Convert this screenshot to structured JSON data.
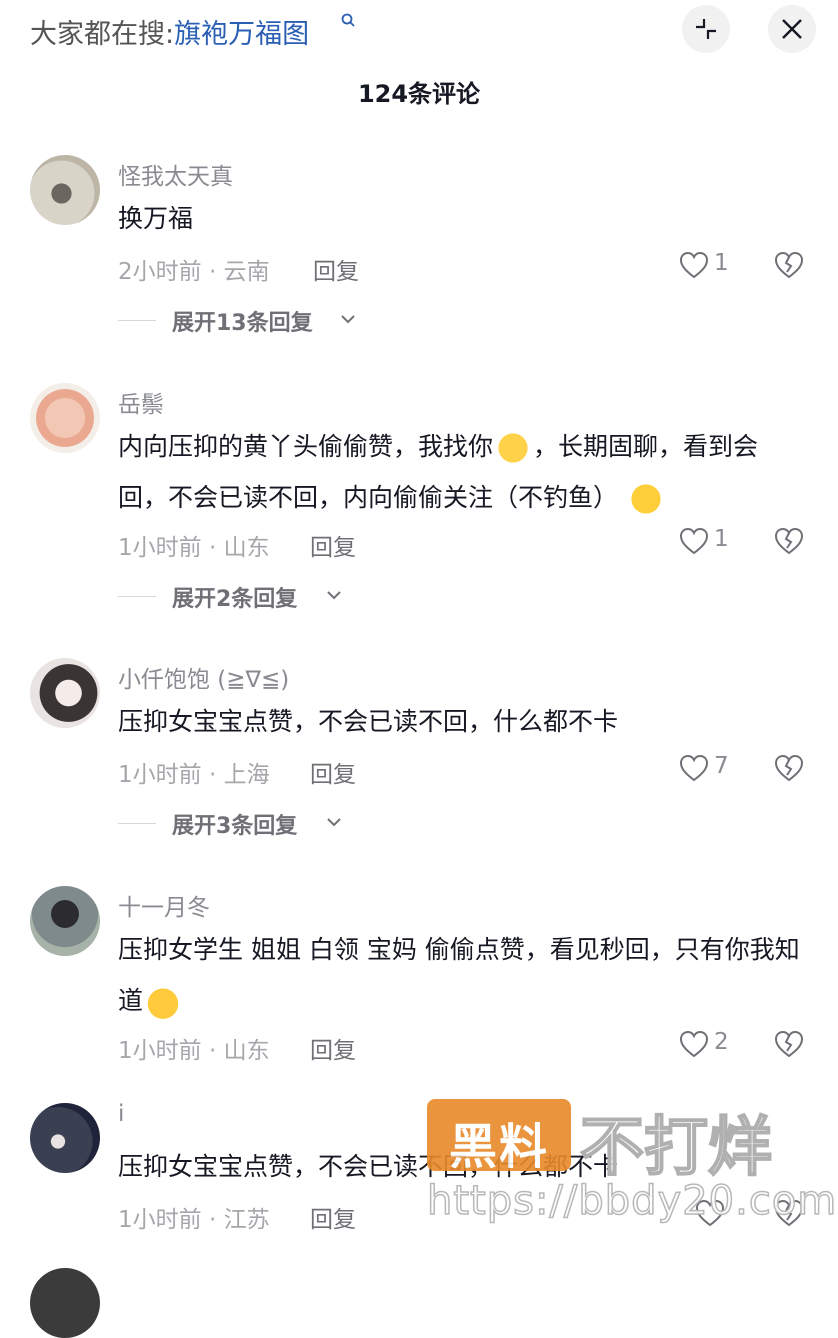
{
  "search": {
    "prefix": "大家都在搜:",
    "term": "旗袍万福图"
  },
  "header": {
    "title": "124条评论"
  },
  "comments": [
    {
      "username": "怪我太天真",
      "text": "换万福",
      "time_location": "2小时前 · 云南",
      "reply_label": "回复",
      "likes": "1",
      "expand_label": "展开13条回复"
    },
    {
      "username": "岳鬃",
      "text": "内向压抑的黄丫头偷偷赞，我找你",
      "text_after_emoji": "，长期固聊，看到会回，不会已读不回，内向偷偷关注（不钓鱼）",
      "time_location": "1小时前 · 山东",
      "reply_label": "回复",
      "likes": "1",
      "expand_label": "展开2条回复"
    },
    {
      "username": "小仟饱饱 (≧∇≦)",
      "text": "压抑女宝宝点赞，不会已读不回，什么都不卡",
      "time_location": "1小时前 · 上海",
      "reply_label": "回复",
      "likes": "7",
      "expand_label": "展开3条回复"
    },
    {
      "username": "十一月冬",
      "text": "压抑女学生 姐姐 白领 宝妈 偷偷点赞，看见秒回，只有你我知道",
      "time_location": "1小时前 · 山东",
      "reply_label": "回复",
      "likes": "2"
    },
    {
      "username": "i",
      "text": "压抑女宝宝点赞，不会已读不回，什么都不卡",
      "time_location": "1小时前 · 江苏",
      "reply_label": "回复"
    }
  ],
  "watermark": {
    "box_text": "黑料",
    "right_text": "不打烊",
    "url": "https://bbdy20.com"
  },
  "icons": {
    "search_hint": "search-icon",
    "collapse": "collapse-icon",
    "close": "close-icon",
    "like": "heart-icon",
    "dislike": "broken-heart-icon",
    "expand": "chevron-down-icon"
  },
  "colors": {
    "search_term": "#2a5fb4",
    "watermark_box": "#e88a2a"
  }
}
